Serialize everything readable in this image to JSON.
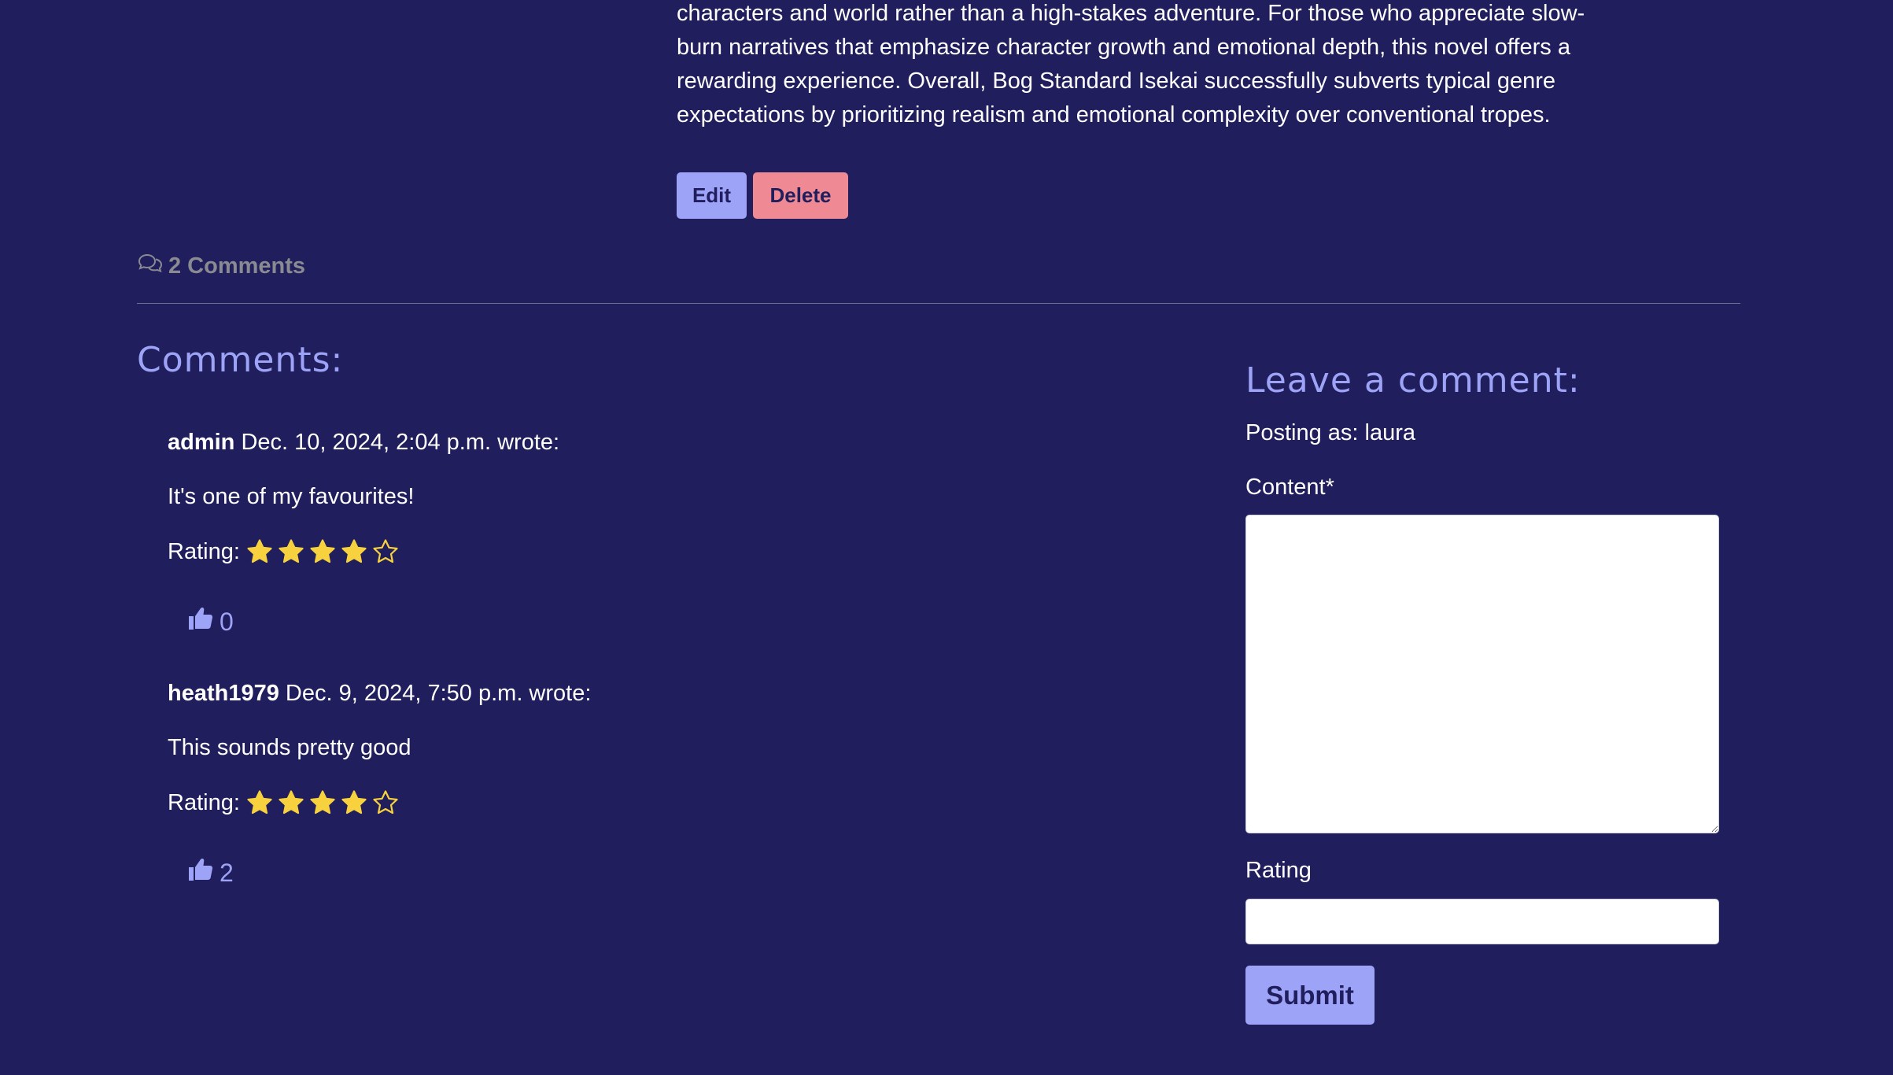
{
  "review": {
    "text_lines": [
      "characters and world rather than a high-stakes adventure. For those who appreciate slow-",
      "burn narratives that emphasize character growth and emotional depth, this novel offers a",
      "rewarding experience. Overall, Bog Standard Isekai successfully subverts typical genre",
      "expectations by prioritizing realism and emotional complexity over conventional tropes."
    ],
    "edit_label": "Edit",
    "delete_label": "Delete"
  },
  "comment_count": {
    "icon": "chat-bubbles-icon",
    "label": "2 Comments"
  },
  "comments": {
    "heading": "Comments:",
    "items": [
      {
        "author": "admin",
        "date_text": "Dec. 10, 2024, 2:04 p.m. wrote:",
        "body": "It's one of my favourites!",
        "rating_label": "Rating:",
        "rating": 4,
        "rating_max": 5,
        "likes": "0"
      },
      {
        "author": "heath1979",
        "date_text": "Dec. 9, 2024, 7:50 p.m. wrote:",
        "body": "This sounds pretty good",
        "rating_label": "Rating:",
        "rating": 4,
        "rating_max": 5,
        "likes": "2"
      }
    ]
  },
  "form": {
    "heading": "Leave a comment:",
    "posting_as": "Posting as: laura",
    "content_label": "Content*",
    "content_value": "",
    "rating_label": "Rating",
    "rating_value": "",
    "submit_label": "Submit"
  },
  "colors": {
    "background": "#201e5c",
    "accent": "#9da3f7",
    "danger": "#ef8a95",
    "star": "#f7d23e",
    "muted": "#8a8a92"
  }
}
